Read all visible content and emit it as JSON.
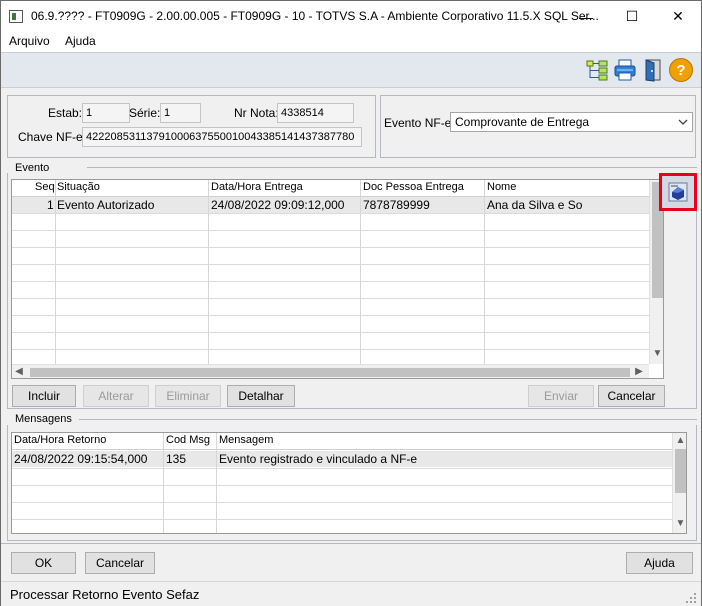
{
  "window": {
    "title": "06.9.???? - FT0909G - 2.00.00.005 - FT0909G - 10 - TOTVS S.A - Ambiente Corporativo 11.5.X SQL Ser...",
    "minimize": "—",
    "maximize": "☐",
    "close": "✕"
  },
  "menu": {
    "arquivo": "Arquivo",
    "ajuda": "Ajuda"
  },
  "toolbar": {
    "icons": [
      "tree-structure-icon",
      "printer-icon",
      "exit-door-icon",
      "help-icon"
    ],
    "help_glyph": "?"
  },
  "header": {
    "estab_label": "Estab:",
    "estab_value": "1",
    "serie_label": "Série:",
    "serie_value": "1",
    "nr_nota_label": "Nr Nota:",
    "nr_nota_value": "4338514",
    "chave_label": "Chave NF-e:",
    "chave_value": "42220853113791000637550010043385141437387780",
    "evento_nfe_label": "Evento NF-e:",
    "evento_nfe_value": "Comprovante de Entrega"
  },
  "evento": {
    "group_title": "Evento",
    "columns": [
      "Seq",
      "Situação",
      "Data/Hora Entrega",
      "Doc Pessoa Entrega",
      "Nome"
    ],
    "rows": [
      {
        "seq": "1",
        "situacao": "Evento Autorizado",
        "data_hora": "24/08/2022 09:09:12,000",
        "doc": "7878789999",
        "nome": "Ana da Silva e So"
      }
    ],
    "buttons": {
      "incluir": "Incluir",
      "alterar": "Alterar",
      "eliminar": "Eliminar",
      "detalhar": "Detalhar",
      "enviar": "Enviar",
      "cancelar": "Cancelar"
    }
  },
  "mensagens": {
    "group_title": "Mensagens",
    "columns": [
      "Data/Hora Retorno",
      "Cod Msg",
      "Mensagem"
    ],
    "rows": [
      {
        "data_hora": "24/08/2022 09:15:54,000",
        "cod": "135",
        "mensagem": "Evento registrado e vinculado a NF-e"
      }
    ]
  },
  "footer": {
    "ok": "OK",
    "cancelar": "Cancelar",
    "ajuda": "Ajuda"
  },
  "status": {
    "text": "Processar Retorno Evento Sefaz"
  },
  "colors": {
    "highlight_border": "#e8001c",
    "toolbar_bg": "#e3e7ee",
    "help_orange": "#f0a000"
  }
}
